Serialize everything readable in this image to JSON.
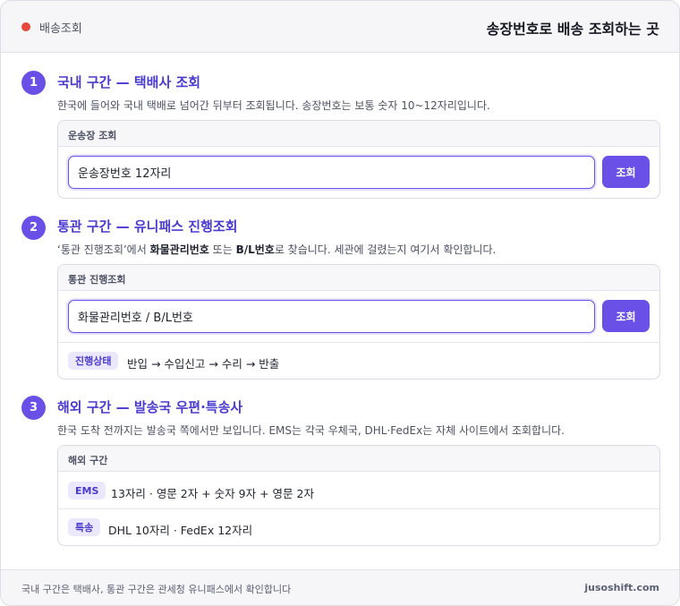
{
  "header": {
    "brand": "배송조회",
    "title": "송장번호로 배송 조회하는 곳"
  },
  "sections": [
    {
      "num": "1",
      "title": "국내 구간 — 택배사 조회",
      "desc": "한국에 들어와 국내 택배로 넘어간 뒤부터 조회됩니다. 송장번호는 보통 숫자 10~12자리입니다.",
      "card_title": "운송장 조회",
      "input_value": "운송장번호 12자리",
      "button": "조회"
    },
    {
      "num": "2",
      "title": "통관 구간 — 유니패스 진행조회",
      "desc_parts": [
        "‘통관 진행조회’에서 ",
        "화물관리번호",
        " 또는 ",
        "B/L번호",
        "로 찾습니다. 세관에 걸렸는지 여기서 확인합니다."
      ],
      "card_title": "통관 진행조회",
      "input_value": "화물관리번호 / B/L번호",
      "button": "조회",
      "status_badge": "진행상태",
      "status_text": "반입 → 수입신고 → 수리 → 반출"
    },
    {
      "num": "3",
      "title": "해외 구간 — 발송국 우편·특송사",
      "desc": "한국 도착 전까지는 발송국 쪽에서만 보입니다. EMS는 각국 우체국, DHL·FedEx는 자체 사이트에서 조회합니다.",
      "card_title": "해외 구간",
      "rows": [
        {
          "badge": "EMS",
          "text": "13자리 · 영문 2자 + 숫자 9자 + 영문 2자"
        },
        {
          "badge": "특송",
          "text": "DHL 10자리 · FedEx 12자리"
        }
      ]
    }
  ],
  "footer": {
    "note": "국내 구간은 택배사, 통관 구간은 관세청 유니패스에서 확인합니다",
    "site": "jusoshift.com"
  },
  "colors": {
    "accent": "#6b50e8",
    "accent_text": "#4a3bd0",
    "brand_dot": "#e5483b"
  }
}
